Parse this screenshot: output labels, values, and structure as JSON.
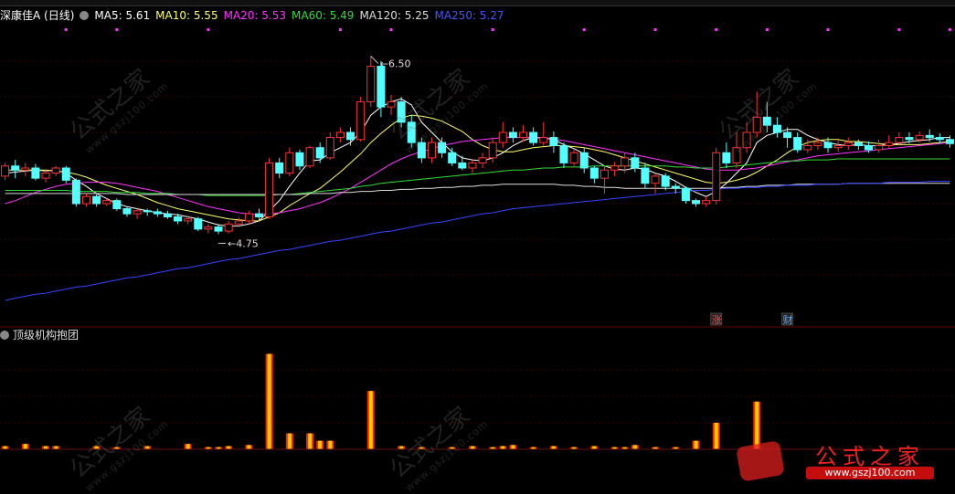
{
  "stock_title": "深康佳A (日线)",
  "ma_legend": [
    {
      "label": "MA5: 5.61",
      "color": "#ffffff"
    },
    {
      "label": "MA10: 5.55",
      "color": "#ffff66"
    },
    {
      "label": "MA20: 5.53",
      "color": "#ff33ff"
    },
    {
      "label": "MA60: 5.49",
      "color": "#33dd33"
    },
    {
      "label": "MA120: 5.25",
      "color": "#dddddd"
    },
    {
      "label": "MA250: 5.27",
      "color": "#3344ff"
    }
  ],
  "indicator_title": "顶级机构抱团",
  "logo": {
    "title": "公式之家",
    "url": "www.gszj100.com"
  },
  "watermarks": [
    {
      "text": "公式之家",
      "sub": "www.gszj100.com"
    }
  ],
  "colors": {
    "up": "#ff3333",
    "down": "#54ffff",
    "background": "#000000",
    "grid": "#3a0000",
    "volume_body": "#ffcc00",
    "volume_edge": "#ff2200"
  },
  "chart_data": {
    "type": "candlestick",
    "title": "深康佳A (日线)",
    "ylim": [
      4.0,
      6.8
    ],
    "annotations": [
      {
        "label": "6.50",
        "x": 36,
        "y": 6.5
      },
      {
        "label": "4.75",
        "x": 21,
        "y": 4.75
      }
    ],
    "event_markers": [
      {
        "label": "涨",
        "x": 70
      },
      {
        "label": "财",
        "x": 77
      }
    ],
    "candles": [
      [
        5.32,
        5.42,
        5.45,
        5.28
      ],
      [
        5.42,
        5.38,
        5.48,
        5.3
      ],
      [
        5.38,
        5.4,
        5.45,
        5.32
      ],
      [
        5.4,
        5.3,
        5.44,
        5.28
      ],
      [
        5.3,
        5.35,
        5.38,
        5.26
      ],
      [
        5.35,
        5.4,
        5.42,
        5.32
      ],
      [
        5.4,
        5.28,
        5.42,
        5.25
      ],
      [
        5.28,
        5.05,
        5.3,
        5.02
      ],
      [
        5.05,
        5.12,
        5.15,
        5.02
      ],
      [
        5.12,
        5.05,
        5.14,
        5.02
      ],
      [
        5.05,
        5.08,
        5.1,
        5.03
      ],
      [
        5.08,
        5.0,
        5.1,
        4.98
      ],
      [
        5.0,
        4.95,
        5.02,
        4.92
      ],
      [
        4.95,
        4.98,
        5.0,
        4.9
      ],
      [
        4.98,
        4.97,
        5.0,
        4.93
      ],
      [
        4.97,
        4.95,
        5.0,
        4.92
      ],
      [
        4.95,
        4.92,
        4.98,
        4.9
      ],
      [
        4.92,
        4.88,
        4.95,
        4.85
      ],
      [
        4.88,
        4.9,
        4.93,
        4.85
      ],
      [
        4.9,
        4.8,
        4.92,
        4.78
      ],
      [
        4.8,
        4.82,
        4.85,
        4.76
      ],
      [
        4.82,
        4.78,
        4.85,
        4.75
      ],
      [
        4.78,
        4.85,
        4.88,
        4.76
      ],
      [
        4.85,
        4.88,
        4.92,
        4.82
      ],
      [
        4.88,
        4.95,
        4.98,
        4.85
      ],
      [
        4.95,
        4.92,
        5.0,
        4.88
      ],
      [
        4.92,
        5.45,
        5.5,
        4.9
      ],
      [
        5.45,
        5.35,
        5.5,
        5.3
      ],
      [
        5.35,
        5.55,
        5.6,
        5.32
      ],
      [
        5.55,
        5.42,
        5.58,
        5.38
      ],
      [
        5.42,
        5.6,
        5.62,
        5.4
      ],
      [
        5.6,
        5.5,
        5.65,
        5.45
      ],
      [
        5.5,
        5.7,
        5.75,
        5.48
      ],
      [
        5.7,
        5.75,
        5.8,
        5.65
      ],
      [
        5.75,
        5.68,
        5.8,
        5.62
      ],
      [
        5.68,
        6.05,
        6.1,
        5.66
      ],
      [
        6.05,
        6.4,
        6.5,
        6.0
      ],
      [
        6.4,
        6.0,
        6.45,
        5.9
      ],
      [
        6.0,
        6.05,
        6.12,
        5.92
      ],
      [
        6.05,
        5.85,
        6.1,
        5.8
      ],
      [
        5.85,
        5.65,
        5.92,
        5.6
      ],
      [
        5.65,
        5.5,
        5.7,
        5.45
      ],
      [
        5.5,
        5.65,
        5.7,
        5.45
      ],
      [
        5.65,
        5.55,
        5.7,
        5.5
      ],
      [
        5.55,
        5.45,
        5.6,
        5.42
      ],
      [
        5.45,
        5.4,
        5.52,
        5.38
      ],
      [
        5.4,
        5.45,
        5.48,
        5.35
      ],
      [
        5.45,
        5.5,
        5.55,
        5.4
      ],
      [
        5.5,
        5.65,
        5.7,
        5.45
      ],
      [
        5.65,
        5.75,
        5.85,
        5.6
      ],
      [
        5.75,
        5.7,
        5.8,
        5.65
      ],
      [
        5.7,
        5.75,
        5.82,
        5.66
      ],
      [
        5.75,
        5.65,
        5.8,
        5.62
      ],
      [
        5.65,
        5.7,
        5.85,
        5.62
      ],
      [
        5.7,
        5.62,
        5.76,
        5.55
      ],
      [
        5.62,
        5.45,
        5.65,
        5.4
      ],
      [
        5.45,
        5.55,
        5.58,
        5.42
      ],
      [
        5.55,
        5.4,
        5.6,
        5.35
      ],
      [
        5.4,
        5.3,
        5.42,
        5.25
      ],
      [
        5.3,
        5.38,
        5.42,
        5.15
      ],
      [
        5.38,
        5.42,
        5.46,
        5.32
      ],
      [
        5.42,
        5.5,
        5.55,
        5.35
      ],
      [
        5.5,
        5.4,
        5.55,
        5.36
      ],
      [
        5.4,
        5.25,
        5.45,
        5.2
      ],
      [
        5.25,
        5.32,
        5.35,
        5.15
      ],
      [
        5.32,
        5.22,
        5.35,
        5.18
      ],
      [
        5.22,
        5.2,
        5.25,
        5.15
      ],
      [
        5.2,
        5.08,
        5.22,
        5.05
      ],
      [
        5.08,
        5.05,
        5.1,
        5.02
      ],
      [
        5.05,
        5.08,
        5.12,
        5.02
      ],
      [
        5.08,
        5.55,
        5.6,
        5.04
      ],
      [
        5.55,
        5.45,
        5.65,
        5.4
      ],
      [
        5.45,
        5.6,
        5.75,
        5.4
      ],
      [
        5.6,
        5.75,
        5.85,
        5.55
      ],
      [
        5.75,
        5.9,
        6.15,
        5.7
      ],
      [
        5.9,
        5.82,
        6.05,
        5.75
      ],
      [
        5.82,
        5.75,
        5.9,
        5.7
      ],
      [
        5.75,
        5.7,
        5.8,
        5.6
      ],
      [
        5.7,
        5.58,
        5.75,
        5.55
      ],
      [
        5.58,
        5.62,
        5.68,
        5.55
      ],
      [
        5.62,
        5.65,
        5.7,
        5.58
      ],
      [
        5.65,
        5.6,
        5.7,
        5.55
      ],
      [
        5.6,
        5.62,
        5.68,
        5.56
      ],
      [
        5.62,
        5.65,
        5.7,
        5.58
      ],
      [
        5.65,
        5.62,
        5.68,
        5.58
      ],
      [
        5.62,
        5.58,
        5.66,
        5.55
      ],
      [
        5.58,
        5.62,
        5.68,
        5.55
      ],
      [
        5.62,
        5.65,
        5.72,
        5.6
      ],
      [
        5.65,
        5.7,
        5.75,
        5.62
      ],
      [
        5.7,
        5.68,
        5.75,
        5.64
      ],
      [
        5.68,
        5.72,
        5.76,
        5.65
      ],
      [
        5.72,
        5.7,
        5.78,
        5.66
      ],
      [
        5.7,
        5.68,
        5.74,
        5.64
      ],
      [
        5.68,
        5.64,
        5.72,
        5.6
      ]
    ],
    "ma_series": [
      {
        "name": "MA5",
        "color": "#ffffff",
        "values": [
          5.35,
          5.36,
          5.37,
          5.38,
          5.37,
          5.38,
          5.35,
          5.28,
          5.22,
          5.15,
          5.1,
          5.05,
          5.02,
          5.0,
          4.98,
          4.96,
          4.95,
          4.94,
          4.92,
          4.9,
          4.87,
          4.84,
          4.83,
          4.83,
          4.85,
          4.88,
          4.98,
          5.08,
          5.22,
          5.35,
          5.47,
          5.48,
          5.55,
          5.6,
          5.65,
          5.75,
          5.92,
          6.0,
          6.05,
          6.08,
          6.02,
          5.85,
          5.75,
          5.65,
          5.56,
          5.5,
          5.48,
          5.47,
          5.5,
          5.55,
          5.62,
          5.67,
          5.7,
          5.7,
          5.68,
          5.63,
          5.59,
          5.54,
          5.48,
          5.42,
          5.39,
          5.38,
          5.4,
          5.39,
          5.35,
          5.32,
          5.27,
          5.21,
          5.16,
          5.12,
          5.17,
          5.25,
          5.35,
          5.45,
          5.65,
          5.72,
          5.75,
          5.78,
          5.78,
          5.72,
          5.68,
          5.65,
          5.63,
          5.62,
          5.63,
          5.62,
          5.62,
          5.63,
          5.64,
          5.66,
          5.67,
          5.68,
          5.7,
          5.7
        ]
      },
      {
        "name": "MA10",
        "color": "#ffff66",
        "values": [
          5.38,
          5.38,
          5.38,
          5.38,
          5.38,
          5.37,
          5.36,
          5.34,
          5.31,
          5.27,
          5.23,
          5.2,
          5.17,
          5.14,
          5.1,
          5.06,
          5.03,
          5.0,
          4.98,
          4.96,
          4.94,
          4.92,
          4.9,
          4.89,
          4.88,
          4.88,
          4.92,
          4.96,
          5.03,
          5.09,
          5.15,
          5.2,
          5.28,
          5.36,
          5.45,
          5.54,
          5.65,
          5.74,
          5.82,
          5.89,
          5.92,
          5.91,
          5.89,
          5.86,
          5.81,
          5.76,
          5.68,
          5.62,
          5.58,
          5.56,
          5.56,
          5.58,
          5.6,
          5.61,
          5.62,
          5.62,
          5.61,
          5.6,
          5.58,
          5.56,
          5.53,
          5.5,
          5.47,
          5.44,
          5.41,
          5.38,
          5.35,
          5.32,
          5.29,
          5.26,
          5.25,
          5.26,
          5.28,
          5.31,
          5.36,
          5.42,
          5.48,
          5.55,
          5.61,
          5.65,
          5.67,
          5.68,
          5.68,
          5.66,
          5.66,
          5.65,
          5.64,
          5.63,
          5.63,
          5.63,
          5.63,
          5.64,
          5.65,
          5.66
        ]
      },
      {
        "name": "MA20",
        "color": "#ff33ff",
        "values": [
          5.05,
          5.08,
          5.12,
          5.16,
          5.19,
          5.22,
          5.24,
          5.25,
          5.26,
          5.26,
          5.26,
          5.25,
          5.23,
          5.21,
          5.19,
          5.17,
          5.14,
          5.11,
          5.08,
          5.05,
          5.02,
          5.0,
          4.98,
          4.96,
          4.95,
          4.94,
          4.95,
          4.96,
          4.98,
          5.0,
          5.03,
          5.06,
          5.1,
          5.15,
          5.2,
          5.26,
          5.32,
          5.38,
          5.44,
          5.49,
          5.53,
          5.56,
          5.59,
          5.62,
          5.64,
          5.66,
          5.67,
          5.68,
          5.69,
          5.7,
          5.7,
          5.7,
          5.7,
          5.69,
          5.68,
          5.67,
          5.65,
          5.63,
          5.61,
          5.59,
          5.57,
          5.55,
          5.53,
          5.51,
          5.49,
          5.47,
          5.45,
          5.43,
          5.41,
          5.39,
          5.38,
          5.38,
          5.38,
          5.39,
          5.4,
          5.42,
          5.44,
          5.46,
          5.48,
          5.5,
          5.52,
          5.53,
          5.54,
          5.55,
          5.56,
          5.57,
          5.58,
          5.59,
          5.6,
          5.61,
          5.62,
          5.63,
          5.64,
          5.65
        ]
      },
      {
        "name": "MA60",
        "color": "#33dd33",
        "values": [
          5.18,
          5.18,
          5.18,
          5.18,
          5.18,
          5.18,
          5.18,
          5.17,
          5.17,
          5.17,
          5.17,
          5.16,
          5.16,
          5.16,
          5.15,
          5.15,
          5.15,
          5.14,
          5.14,
          5.14,
          5.13,
          5.13,
          5.13,
          5.13,
          5.13,
          5.13,
          5.13,
          5.14,
          5.14,
          5.15,
          5.16,
          5.17,
          5.18,
          5.19,
          5.2,
          5.22,
          5.23,
          5.25,
          5.26,
          5.27,
          5.28,
          5.29,
          5.3,
          5.31,
          5.32,
          5.33,
          5.34,
          5.35,
          5.36,
          5.37,
          5.38,
          5.38,
          5.39,
          5.4,
          5.4,
          5.41,
          5.41,
          5.41,
          5.42,
          5.42,
          5.42,
          5.42,
          5.42,
          5.42,
          5.42,
          5.42,
          5.41,
          5.41,
          5.4,
          5.4,
          5.4,
          5.41,
          5.42,
          5.43,
          5.44,
          5.45,
          5.46,
          5.47,
          5.47,
          5.48,
          5.48,
          5.48,
          5.49,
          5.49,
          5.49,
          5.49,
          5.49,
          5.49,
          5.49,
          5.49,
          5.49,
          5.49,
          5.49,
          5.49
        ]
      },
      {
        "name": "MA120",
        "color": "#dddddd",
        "values": [
          5.15,
          5.15,
          5.15,
          5.15,
          5.15,
          5.15,
          5.15,
          5.15,
          5.15,
          5.15,
          5.15,
          5.15,
          5.14,
          5.14,
          5.14,
          5.14,
          5.14,
          5.14,
          5.14,
          5.14,
          5.14,
          5.14,
          5.14,
          5.14,
          5.14,
          5.14,
          5.14,
          5.14,
          5.14,
          5.14,
          5.15,
          5.15,
          5.15,
          5.16,
          5.16,
          5.17,
          5.17,
          5.18,
          5.18,
          5.19,
          5.19,
          5.2,
          5.2,
          5.21,
          5.21,
          5.22,
          5.22,
          5.23,
          5.23,
          5.24,
          5.24,
          5.24,
          5.24,
          5.24,
          5.24,
          5.23,
          5.23,
          5.22,
          5.22,
          5.21,
          5.21,
          5.2,
          5.2,
          5.2,
          5.2,
          5.2,
          5.2,
          5.2,
          5.2,
          5.2,
          5.2,
          5.21,
          5.21,
          5.22,
          5.22,
          5.23,
          5.23,
          5.23,
          5.24,
          5.24,
          5.24,
          5.24,
          5.24,
          5.25,
          5.25,
          5.25,
          5.25,
          5.25,
          5.25,
          5.25,
          5.25,
          5.25,
          5.25,
          5.25
        ]
      },
      {
        "name": "MA250",
        "color": "#3344ff",
        "values": [
          4.1,
          4.12,
          4.14,
          4.16,
          4.17,
          4.19,
          4.21,
          4.23,
          4.24,
          4.26,
          4.28,
          4.3,
          4.32,
          4.33,
          4.35,
          4.37,
          4.39,
          4.41,
          4.42,
          4.44,
          4.46,
          4.48,
          4.5,
          4.51,
          4.53,
          4.55,
          4.57,
          4.59,
          4.6,
          4.62,
          4.64,
          4.66,
          4.68,
          4.69,
          4.71,
          4.73,
          4.75,
          4.77,
          4.78,
          4.8,
          4.82,
          4.84,
          4.86,
          4.87,
          4.89,
          4.91,
          4.93,
          4.95,
          4.96,
          4.98,
          5.0,
          5.01,
          5.02,
          5.03,
          5.04,
          5.05,
          5.06,
          5.07,
          5.08,
          5.09,
          5.1,
          5.11,
          5.12,
          5.13,
          5.14,
          5.15,
          5.16,
          5.17,
          5.18,
          5.18,
          5.19,
          5.2,
          5.2,
          5.21,
          5.21,
          5.22,
          5.22,
          5.23,
          5.23,
          5.23,
          5.24,
          5.24,
          5.24,
          5.25,
          5.25,
          5.25,
          5.25,
          5.26,
          5.26,
          5.26,
          5.26,
          5.27,
          5.27,
          5.27
        ]
      }
    ],
    "indicator": {
      "type": "bar",
      "ylim": [
        0,
        10
      ],
      "values": [
        0.3,
        0,
        0.5,
        0,
        0.3,
        0.3,
        0,
        0,
        0,
        0.3,
        0,
        0.2,
        0,
        0,
        0.3,
        0,
        0,
        0,
        0.5,
        0,
        0.2,
        0.2,
        0.3,
        0,
        0.4,
        0,
        9.0,
        0,
        1.5,
        0,
        1.5,
        0.8,
        0.8,
        0,
        0,
        0,
        5.5,
        0,
        0,
        0.3,
        0,
        0.2,
        0,
        0,
        0.2,
        0,
        0.3,
        0,
        0.2,
        0.3,
        0.4,
        0,
        0.2,
        0,
        0.3,
        0,
        0.2,
        0,
        0.3,
        0,
        0.2,
        0.2,
        0.4,
        0,
        0.2,
        0,
        0.2,
        0,
        0.8,
        0,
        2.5,
        0,
        0,
        0,
        4.5,
        0,
        0,
        0,
        0,
        0,
        0,
        0,
        0,
        0,
        0,
        0,
        0,
        0,
        0,
        0,
        0,
        0,
        0,
        0
      ]
    }
  }
}
